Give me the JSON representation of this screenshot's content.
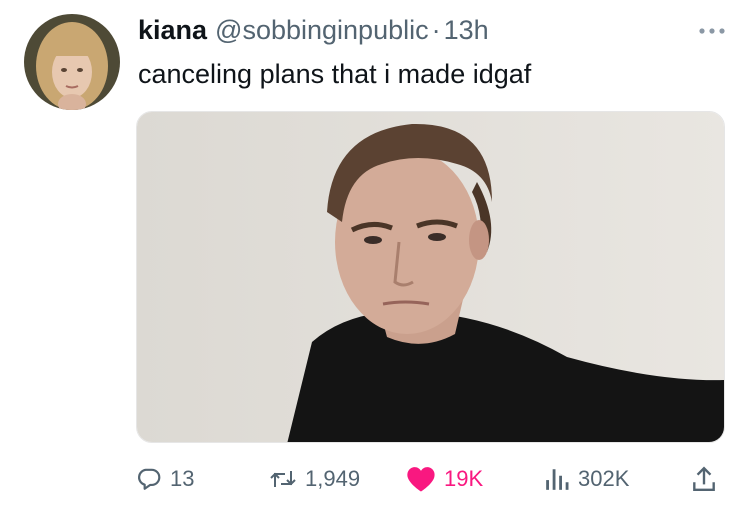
{
  "tweet": {
    "author": {
      "display_name": "kiana",
      "handle": "@sobbinginpublic",
      "separator": "·",
      "timestamp": "13h"
    },
    "text": "canceling plans that i made idgaf",
    "more_icon": "more-horizontal-icon"
  },
  "actions": {
    "reply": {
      "icon": "reply-icon",
      "count": "13"
    },
    "retweet": {
      "icon": "retweet-icon",
      "count": "1,949"
    },
    "like": {
      "icon": "heart-icon",
      "count": "19K",
      "liked": true,
      "color": "#f91880"
    },
    "views": {
      "icon": "views-chart-icon",
      "count": "302K"
    },
    "share": {
      "icon": "share-icon"
    }
  },
  "colors": {
    "primary_text": "#0f1419",
    "secondary_text": "#536471",
    "like_active": "#f91880"
  }
}
